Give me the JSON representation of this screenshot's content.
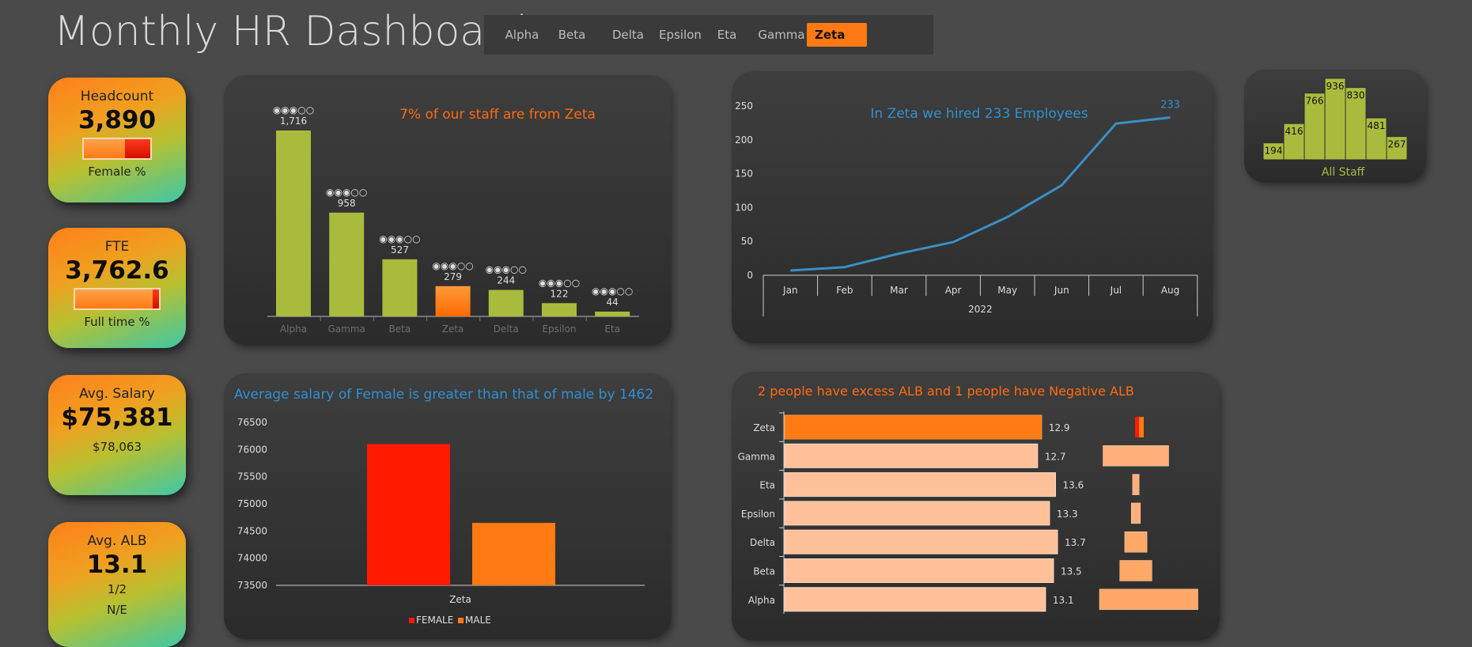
{
  "title": "Monthly HR Dashboard",
  "tabs": [
    {
      "label": "Alpha",
      "active": false
    },
    {
      "label": "Beta",
      "active": false
    },
    {
      "label": "Delta",
      "active": false
    },
    {
      "label": "Epsilon",
      "active": false
    },
    {
      "label": "Eta",
      "active": false
    },
    {
      "label": "Gamma",
      "active": false
    },
    {
      "label": "Zeta",
      "active": true
    }
  ],
  "kpis": {
    "headcount": {
      "label": "Headcount",
      "value": "3,890",
      "sub": "Female %",
      "bar_fraction": 0.38
    },
    "fte": {
      "label": "FTE",
      "value": "3,762.6",
      "sub": "Full time %",
      "bar_fraction": 0.08
    },
    "salary": {
      "label": "Avg. Salary",
      "value": "$75,381",
      "sub": "$78,063"
    },
    "alb": {
      "label": "Avg. ALB",
      "value": "13.1",
      "sub1": "1/2",
      "sub2": "N/E"
    }
  },
  "colors": {
    "green": "#a9bb3d",
    "orange": "#ff7a12",
    "red": "#ff1a00",
    "peach": "#ffc09a",
    "blue": "#2f8fd0",
    "text_orange": "#ff6a10"
  },
  "chart_data": [
    {
      "type": "bar",
      "title": "7% of our staff are from Zeta",
      "categories": [
        "Alpha",
        "Gamma",
        "Beta",
        "Zeta",
        "Delta",
        "Epsilon",
        "Eta"
      ],
      "values": [
        1716,
        958,
        527,
        279,
        244,
        122,
        44
      ],
      "rating_labels": [
        "◉◉◉○○",
        "◉◉◉○○",
        "◉◉◉○○",
        "◉◉◉○○",
        "◉◉◉○○",
        "◉◉◉○○",
        "◉◉◉○○"
      ],
      "data_labels": [
        "1,716",
        "958",
        "527",
        "279",
        "244",
        "122",
        "44"
      ],
      "highlight": "Zeta"
    },
    {
      "type": "line",
      "title": "In Zeta we hired 233 Employees",
      "categories": [
        "Jan",
        "Feb",
        "Mar",
        "Apr",
        "May",
        "Jun",
        "Jul",
        "Aug"
      ],
      "values": [
        7,
        12,
        32,
        49,
        86,
        133,
        224,
        233
      ],
      "end_label": "233",
      "year_label": "2022",
      "ylim": [
        0,
        250
      ],
      "yticks": [
        0,
        50,
        100,
        150,
        200,
        250
      ]
    },
    {
      "type": "bar",
      "title": "All Staff",
      "values": [
        194,
        416,
        766,
        936,
        830,
        481,
        267
      ],
      "data_labels": [
        "194",
        "416",
        "766",
        "936",
        "830",
        "481",
        "267"
      ]
    },
    {
      "type": "bar",
      "title": "Average salary of Female is greater than that of male by 1462",
      "categories": [
        "Zeta"
      ],
      "series": [
        {
          "name": "FEMALE",
          "values": [
            76100
          ]
        },
        {
          "name": "MALE",
          "values": [
            74650
          ]
        }
      ],
      "ylim": [
        73500,
        76500
      ],
      "yticks": [
        "76500",
        "76000",
        "75500",
        "75000",
        "74500",
        "74000",
        "73500"
      ]
    },
    {
      "type": "bar",
      "title": "2 people have excess ALB and 1 people have Negative ALB",
      "categories": [
        "Zeta",
        "Gamma",
        "Eta",
        "Epsilon",
        "Delta",
        "Beta",
        "Alpha"
      ],
      "values": [
        12.9,
        12.7,
        13.6,
        13.3,
        13.7,
        13.5,
        13.1
      ],
      "data_labels": [
        "12.9",
        "12.7",
        "13.6",
        "13.3",
        "13.7",
        "13.5",
        "13.1"
      ],
      "side_values": [
        0.1,
        1.0,
        0.1,
        0.14,
        0.34,
        0.49,
        1.5
      ],
      "highlight": "Zeta"
    }
  ]
}
